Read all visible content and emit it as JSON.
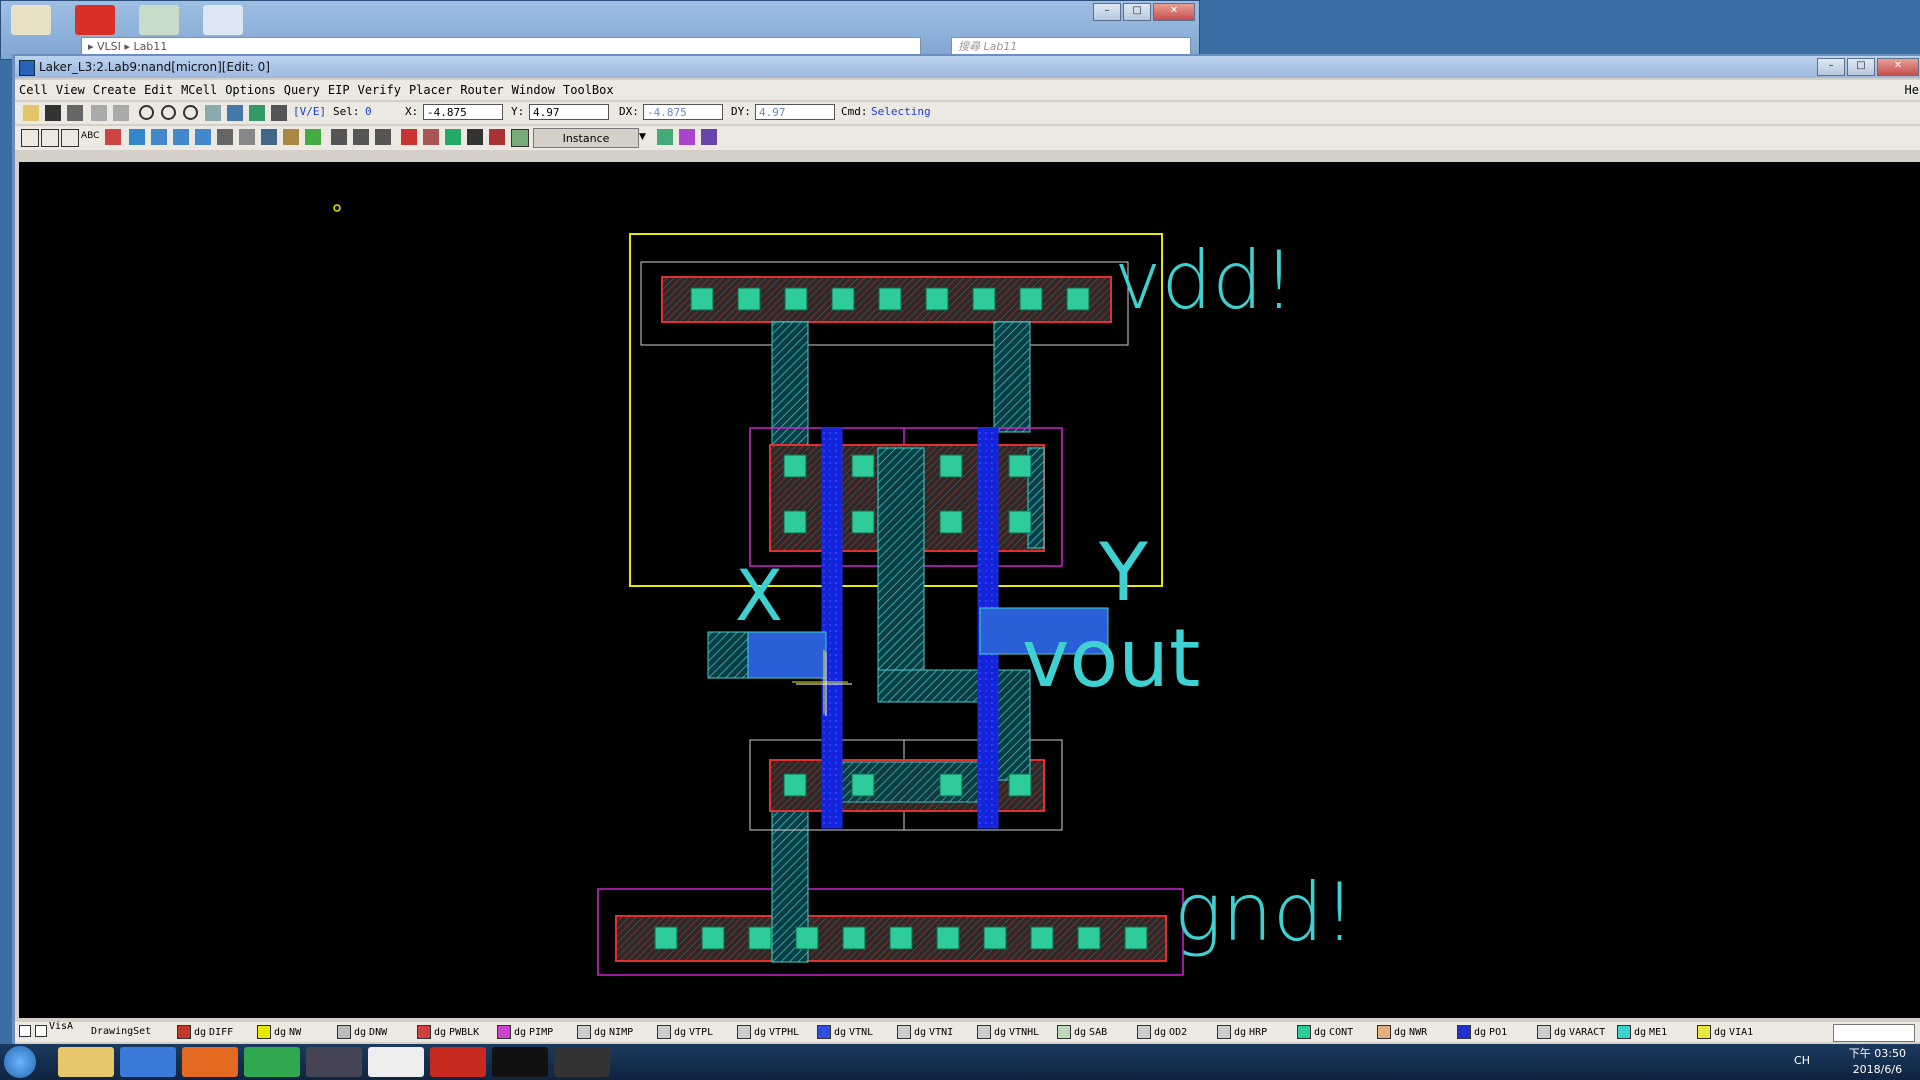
{
  "explorer": {
    "path": [
      "VLSI",
      "Lab11"
    ],
    "search_placeholder": "搜尋 Lab11"
  },
  "app": {
    "title": "Laker_L3:2.Lab9:nand[micron][Edit: 0]",
    "menu": [
      "Cell",
      "View",
      "Create",
      "Edit",
      "MCell",
      "Options",
      "Query",
      "EIP",
      "Verify",
      "Placer",
      "Router",
      "Window",
      "ToolBox"
    ],
    "help_menu": "He",
    "mode_label": "[V/E]",
    "sel_label": "Sel:",
    "sel_value": "0",
    "x_label": "X:",
    "x_value": "-4.875",
    "y_label": "Y:",
    "y_value": "4.97",
    "dx_label": "DX:",
    "dx_value": "-4.875",
    "dy_label": "DY:",
    "dy_value": "4.97",
    "cmd_label": "Cmd:",
    "cmd_value": "Selecting",
    "select_mode": "Instance"
  },
  "layout_labels": {
    "vdd": "vdd!",
    "gnd": "gnd!",
    "x": "X",
    "y": "Y",
    "vout": "vout"
  },
  "layer_bar": {
    "vis_label": "VisA",
    "drawing_set": "DrawingSet",
    "layers": [
      {
        "name": "DIFF",
        "purpose": "dg",
        "color": "#c0392b"
      },
      {
        "name": "NW",
        "purpose": "dg",
        "color": "#e8e800"
      },
      {
        "name": "DNW",
        "purpose": "dg",
        "color": "#bbbbbb"
      },
      {
        "name": "PWBLK",
        "purpose": "dg",
        "color": "#d04040"
      },
      {
        "name": "PIMP",
        "purpose": "dg",
        "color": "#d040d0"
      },
      {
        "name": "NIMP",
        "purpose": "dg",
        "color": "#cccccc"
      },
      {
        "name": "VTPL",
        "purpose": "dg",
        "color": "#cccccc"
      },
      {
        "name": "VTPHL",
        "purpose": "dg",
        "color": "#cccccc"
      },
      {
        "name": "VTNL",
        "purpose": "dg",
        "color": "#3050e0"
      },
      {
        "name": "VTNI",
        "purpose": "dg",
        "color": "#cccccc"
      },
      {
        "name": "VTNHL",
        "purpose": "dg",
        "color": "#cccccc"
      },
      {
        "name": "SAB",
        "purpose": "dg",
        "color": "#bbd8bb"
      },
      {
        "name": "OD2",
        "purpose": "dg",
        "color": "#cccccc"
      },
      {
        "name": "HRP",
        "purpose": "dg",
        "color": "#cccccc"
      },
      {
        "name": "CONT",
        "purpose": "dg",
        "color": "#2ecc9a"
      },
      {
        "name": "NWR",
        "purpose": "dg",
        "color": "#e0b080"
      },
      {
        "name": "PO1",
        "purpose": "dg",
        "color": "#2030d0"
      },
      {
        "name": "VARACT",
        "purpose": "dg",
        "color": "#cccccc"
      },
      {
        "name": "ME1",
        "purpose": "dg",
        "color": "#40d0d0"
      },
      {
        "name": "VIA1",
        "purpose": "dg",
        "color": "#e8e840"
      }
    ]
  },
  "taskbar": {
    "lang": "CH",
    "time": "下午 03:50",
    "date": "2018/6/6"
  }
}
